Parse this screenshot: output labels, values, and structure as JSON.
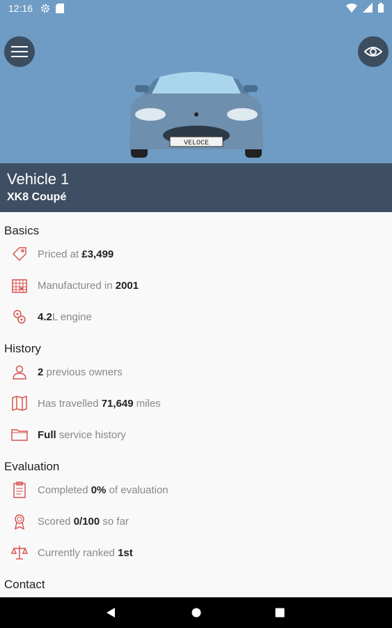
{
  "status_bar": {
    "time": "12:16"
  },
  "vehicle": {
    "name": "Vehicle 1",
    "model": "XK8 Coupé",
    "plate": "VELOCE"
  },
  "sections": {
    "basics": {
      "title": "Basics",
      "rows": [
        {
          "pre": "Priced at ",
          "value": "£3,499",
          "post": ""
        },
        {
          "pre": "Manufactured in ",
          "value": "2001",
          "post": ""
        },
        {
          "pre": "",
          "value": "4.2",
          "post": "L engine"
        }
      ]
    },
    "history": {
      "title": "History",
      "rows": [
        {
          "pre": "",
          "value": "2",
          "post": " previous owners"
        },
        {
          "pre": "Has travelled ",
          "value": "71,649",
          "post": " miles"
        },
        {
          "pre": "",
          "value": "Full",
          "post": " service history"
        }
      ]
    },
    "evaluation": {
      "title": "Evaluation",
      "rows": [
        {
          "pre": "Completed ",
          "value": "0%",
          "post": " of evaluation"
        },
        {
          "pre": "Scored ",
          "value": "0/100",
          "post": " so far"
        },
        {
          "pre": "Currently ranked ",
          "value": "1st",
          "post": ""
        }
      ]
    },
    "contact": {
      "title": "Contact"
    }
  },
  "colors": {
    "header_bg": "#6f9cc4",
    "titlebar_bg": "#3e4f63",
    "icon_red": "#d9534f"
  }
}
